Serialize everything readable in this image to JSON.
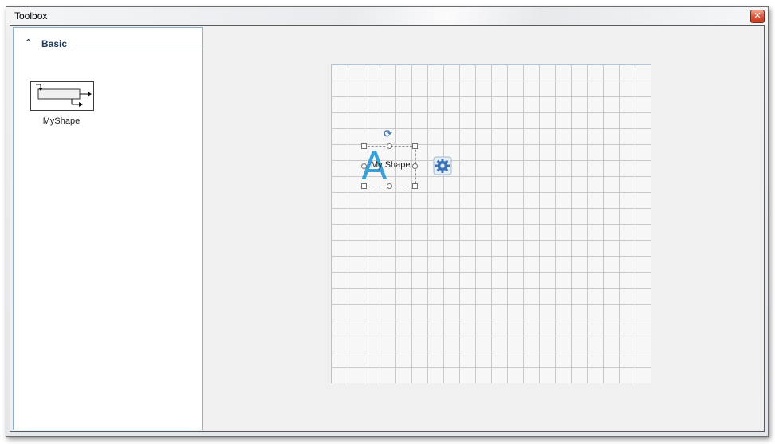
{
  "window": {
    "title": "Toolbox",
    "close_glyph": "✕"
  },
  "toolbox": {
    "group": {
      "title": "Basic",
      "chevron_glyph": "⌃",
      "chevron_icon": "chevron-up-icon"
    },
    "items": [
      {
        "label": "MyShape",
        "icon": "myshape-thumbnail"
      }
    ]
  },
  "canvas": {
    "shape": {
      "glyph": "A",
      "text": "My Shape",
      "rotate_glyph": "⟳"
    },
    "settings_icon": "gear-icon",
    "colors": {
      "accent": "#3aa0d6",
      "settings": "#3b73b9",
      "grid": "#c9c9c9"
    }
  }
}
